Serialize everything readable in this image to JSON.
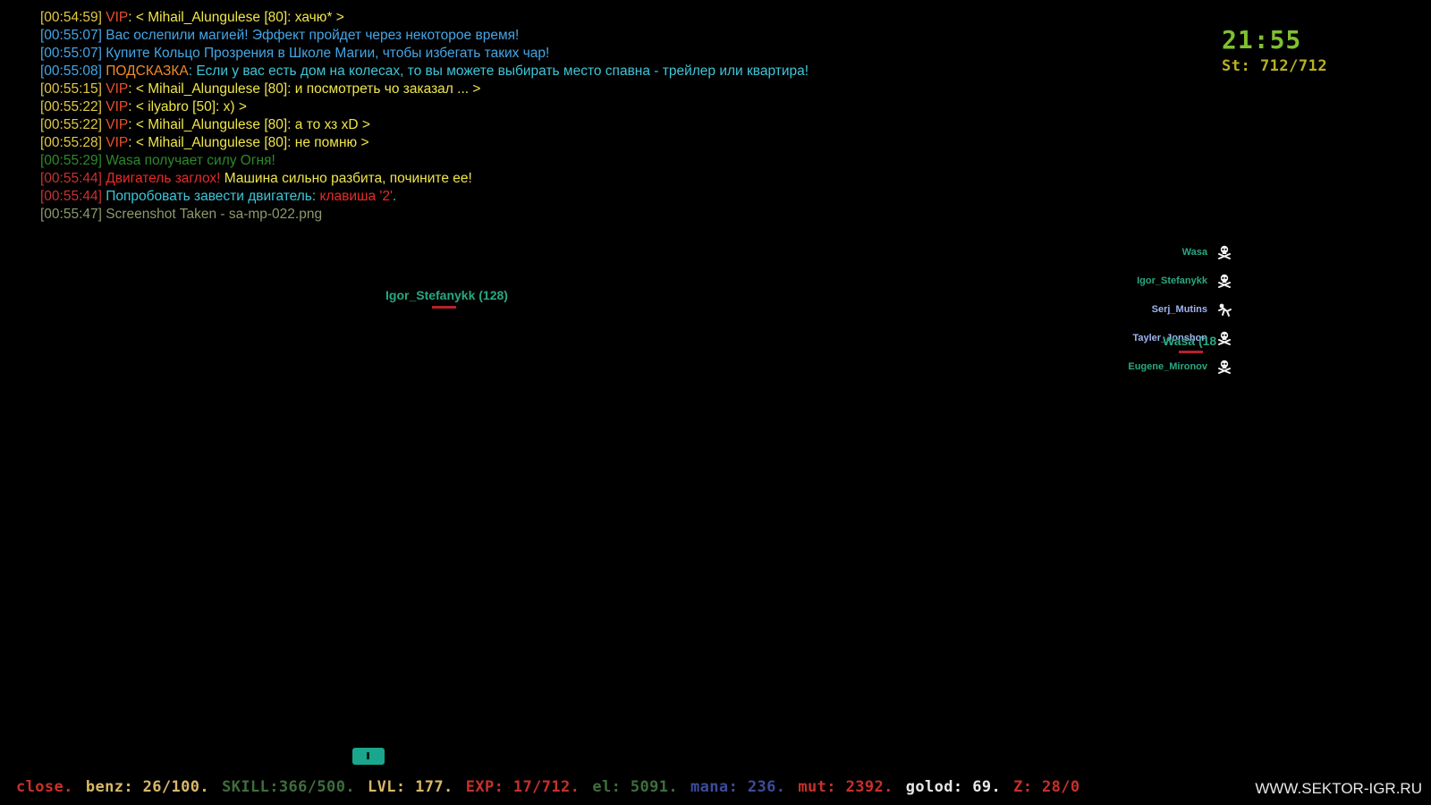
{
  "chat": [
    {
      "segments": [
        {
          "t": "[00:54:59] ",
          "c": "#e0c846"
        },
        {
          "t": "VIP",
          "c": "#e8502d"
        },
        {
          "t": ": < Mihail_Alungulese [80]: хачю* >",
          "c": "#f0e64a"
        }
      ]
    },
    {
      "segments": [
        {
          "t": "[00:55:07] ",
          "c": "#44a6e6"
        },
        {
          "t": "Вас ослепили магией! Эффект пройдет через некоторое время!",
          "c": "#44a6e6"
        }
      ]
    },
    {
      "segments": [
        {
          "t": "[00:55:07] ",
          "c": "#44a6e6"
        },
        {
          "t": "Купите Кольцо Прозрения в Школе Магии, чтобы избегать таких чар!",
          "c": "#44a6e6"
        }
      ]
    },
    {
      "segments": [
        {
          "t": "[00:55:08] ",
          "c": "#44a6e6"
        },
        {
          "t": "ПОДСКАЗКА",
          "c": "#f08a28"
        },
        {
          "t": ": Если у вас есть дом на колесах, то вы можете выбирать место спавна - трейлер или квартира!",
          "c": "#3ec6d8"
        }
      ]
    },
    {
      "segments": [
        {
          "t": "[00:55:15] ",
          "c": "#e0c846"
        },
        {
          "t": "VIP",
          "c": "#e8502d"
        },
        {
          "t": ": < Mihail_Alungulese [80]: и посмотреть чо заказал ... >",
          "c": "#f0e64a"
        }
      ]
    },
    {
      "segments": [
        {
          "t": "[00:55:22] ",
          "c": "#e0c846"
        },
        {
          "t": "VIP",
          "c": "#e8502d"
        },
        {
          "t": ": < ilyabro [50]: x) >",
          "c": "#f0e64a"
        }
      ]
    },
    {
      "segments": [
        {
          "t": "[00:55:22] ",
          "c": "#e0c846"
        },
        {
          "t": "VIP",
          "c": "#e8502d"
        },
        {
          "t": ": < Mihail_Alungulese [80]: а то хз xD >",
          "c": "#f0e64a"
        }
      ]
    },
    {
      "segments": [
        {
          "t": "[00:55:28] ",
          "c": "#e0c846"
        },
        {
          "t": "VIP",
          "c": "#e8502d"
        },
        {
          "t": ": < Mihail_Alungulese [80]: не помню >",
          "c": "#f0e64a"
        }
      ]
    },
    {
      "segments": [
        {
          "t": "[00:55:29] ",
          "c": "#2c8a2c"
        },
        {
          "t": "Wasa получает силу Огня!",
          "c": "#2c8a2c"
        }
      ]
    },
    {
      "segments": [
        {
          "t": "[00:55:44] ",
          "c": "#c83232"
        },
        {
          "t": "Двигатель заглох! ",
          "c": "#e82a2a"
        },
        {
          "t": "Машина сильно разбита, почините ее!",
          "c": "#f0e64a"
        }
      ]
    },
    {
      "segments": [
        {
          "t": "[00:55:44] ",
          "c": "#c83232"
        },
        {
          "t": "Попробовать завести двигатель: ",
          "c": "#3ec6d8"
        },
        {
          "t": "клавиша '2'",
          "c": "#e82a2a"
        },
        {
          "t": ".",
          "c": "#3ec6d8"
        }
      ]
    },
    {
      "segments": [
        {
          "t": "[00:55:47] ",
          "c": "#8c9a6e"
        },
        {
          "t": "Screenshot Taken - sa-mp-022.png",
          "c": "#8c9a6e"
        }
      ]
    }
  ],
  "hud": {
    "clock": "21:55",
    "stamina": "St: 712/712"
  },
  "killlist": [
    {
      "name": "Wasa",
      "color": "#2aa882",
      "icon": "skull-crossbones-icon"
    },
    {
      "name": "Igor_Stefanykk",
      "color": "#2aa882",
      "icon": "skull-crossbones-icon"
    },
    {
      "name": "Serj_Mutins",
      "color": "#a0b4f0",
      "icon": "fall-death-icon"
    },
    {
      "name": "Tayler_Jonshon",
      "color": "#a0b4f0",
      "icon": "skull-crossbones-icon"
    },
    {
      "name": "Eugene_Mironov",
      "color": "#2aa882",
      "icon": "skull-crossbones-icon"
    }
  ],
  "nametags": [
    {
      "text": "Igor_Stefanykk (128)",
      "color": "#2aa882",
      "health": 0.7
    },
    {
      "text": "Wasa (18",
      "color": "#2aa882",
      "health": 0.7
    }
  ],
  "statusbar": [
    {
      "text": "close.",
      "color": "#c8302c"
    },
    {
      "text": "benz: 26/100.",
      "color": "#d8b868"
    },
    {
      "text": "SKILL:366/500.",
      "color": "#3e6e3c"
    },
    {
      "text": "LVL: 177.",
      "color": "#d8b868"
    },
    {
      "text": "EXP: 17/712.",
      "color": "#c8302c"
    },
    {
      "text": "el: 5091.",
      "color": "#3e6e3c"
    },
    {
      "text": "mana: 236.",
      "color": "#3c4c9c"
    },
    {
      "text": "mut: 2392.",
      "color": "#c8302c"
    },
    {
      "text": "golod: 69.",
      "color": "#e8e8e8"
    },
    {
      "text": "Z: 28/0",
      "color": "#c8302c"
    }
  ],
  "watermark": "WWW.SEKTOR-IGR.RU",
  "colors": {
    "background": "#000000",
    "health_bar": "#b8202a",
    "marker": "#1aa68c"
  }
}
